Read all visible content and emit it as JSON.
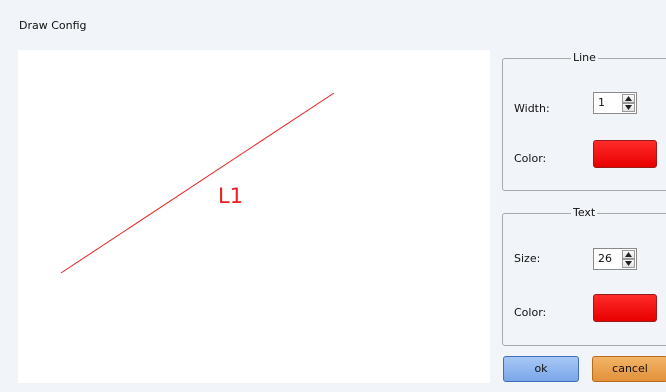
{
  "dialog": {
    "title": "Draw Config"
  },
  "preview": {
    "line_color": "#e82020",
    "label_text": "L1",
    "label_color": "#e82020"
  },
  "line_group": {
    "legend": "Line",
    "width_label": "Width:",
    "width_value": "1",
    "color_label": "Color:",
    "color_value": "#ff0000"
  },
  "text_group": {
    "legend": "Text",
    "size_label": "Size:",
    "size_value": "26",
    "color_label": "Color:",
    "color_value": "#ff0000"
  },
  "buttons": {
    "ok_label": "ok",
    "cancel_label": "cancel"
  }
}
